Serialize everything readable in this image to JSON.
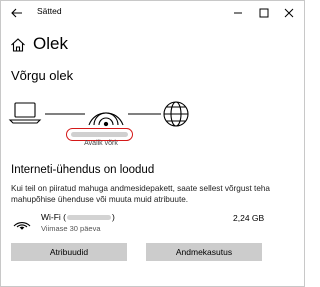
{
  "window": {
    "title": "Sätted"
  },
  "header": {
    "title": "Olek"
  },
  "network_status": {
    "section_title": "Võrgu olek",
    "network_caption": "Avalik võrk"
  },
  "connection": {
    "title": "Interneti-ühendus on loodud",
    "description": "Kui teil on piiratud mahuga andmesidepakett, saate sellest võrgust teha mahupõhise ühenduse või muuta muid atribuute.",
    "adapter_prefix": "Wi-Fi (",
    "adapter_suffix": ")",
    "adapter_period": "Viimase 30 päeva",
    "data_usage": "2,24 GB"
  },
  "buttons": {
    "properties": "Atribuudid",
    "data_usage": "Andmekasutus"
  },
  "colors": {
    "redaction_outline": "#d41818",
    "button_bg": "#cccccc"
  }
}
